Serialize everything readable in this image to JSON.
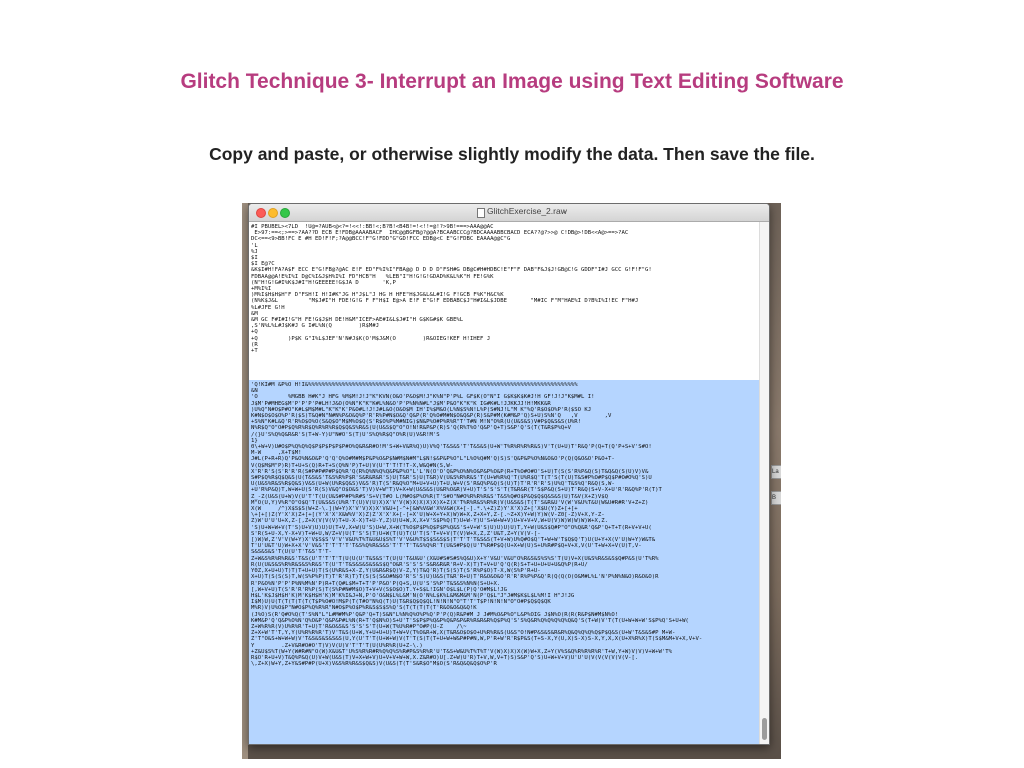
{
  "slide": {
    "title": "Glitch Technique 3- Interrupt an Image using Text Editing Software",
    "subtitle": "Copy and paste, or otherwise slightly modify the data. Then save the file."
  },
  "window": {
    "title": "GlitchExercise_2.raw",
    "title_chevron": "⌄"
  },
  "side_labels": [
    "La",
    "B"
  ],
  "editor": {
    "top_text": "#I PBUBEL><7LD  !U@=?AUB<@<?=!<<!:BB!<;B?B!<B4B!=!<!!=@!?>9B!===>AAA@@AC\n E>97:==<;>==>?AA??D ECB E!FDB@AAAABACF  IHC@@BGFB@?@@A?BCAABCCC@?BDCAAAABBCBACD ECA??@?>>@ C!DB@>!DB<<A@>==>?AC\nDC<==<9>BB!FC E #H ED!F!F;?A@@BCC!F\"G!FDD\"G\"GD!FCC EDB@<C E\"G!FDBC EAAAA@@C\"G\n'L\n%J\n$I\n$I E@?C\n&K$I#H!FA?A$F ECC E\"G!FB@?@AC E!F ED\"F%I%I\"FBA@@ D D D D\"FSH#G DB@C#H#HDBC!E\"F\"F DAB\"F&J$J!GB@C!G GDDF\"I#J GCC G!F!F\"G!\nFDBAA@@A!E%I%I D@C%I&J$H%I%I FD\"HCB\"H   %LEB\"I\"H!G!G!GDAD%K&L%K\"H FE!G%K\n(N\"H!G!G#I%K$J#I\"H!GEEEEE!G$JA D       'K,P\n+M%I%I\n)M%I$H$H$H\"F D\"FSH!I H!I#K\"JG H\"J$L\"J HG H HFE\"H$JG&L&L#I!G F!GCB F%K\"H&C%K\n(N%K$J&L         \"M$J#I\"H FDE!G!G F F\"H$I E@>A E!F E\"G!F EDBABC$J\"H#I&L$JDBE       \"M#IC F\"M\"HAE%I D?B%I%I!EC F\"H#J\n%L#JFE G!H\n&M\n&M GC F#I#I!G\"H FE!G$J$H DE!H&M\"ICEF>AE#I&L$J#I\"H G$KG#$K GBE%L\n,S'N%L%L#J$K#J G I#L%N(Q        )R$M#J\n+Q\n+Q         )P$K G\"I%L$JEF'N'N#J$K(O'M$J&M(O        )R&OIEG!KEF H!IHEF J\n(R\n+T",
    "selected_text": "'Q!KI#M &P%O H!I&%%%%%%%%%%%%%%%%%%%%%%%%%%%%%%%%%%%%%%%%%%%%%%%%%%%%%%%%%%%%%%%%%%%%%%%%%%%%%%%%\n&N\n'O         %MGBB H#K\"J HFG %M$M!J!J\"K\"KVN(O&O'P&O$M!J\"K%N\"P'P%L GF$K(O\"N\"I G$K$K$K#J!H GF!J!J\"K$M#L I!\nJ$M'P#MHEG$M'P'P'P'P#LH!J&O(O%N\"K\"K\"K#L%N&O'P'P%N%N#L\"J$M'P&O\"K\"K\"K IG#K#L!JJKKJJ!H!MKK&R\n)U%Q\"N#O$P#O\"K#L$M$M#L\"K\"K\"K'P&O#L!J!J#L&O(O&O$M IH'I%$M&O(L%N$S%N!L%P(S#NJ!L\"M K\"%Q'R$O$O%P'R($SO KJ\nK#N$O$O$O%P'R($S)T&Q#N\"N#N%P&O&Q%P'R'R%P#N$O&Q'Q&P(R'Q%O#M#N$O&Q&P(R)S&P#M(K#M&P'Q)S+U)S%N'Q   ,V        ,V\n+S%N\"K#L&Q'R'R%O$O%O(S&Q$O\"M$M%O$Q(S'R$O%P%M#NIG)$N&P%O#P%R%R\"T'T#N M!N\"O%R(U(U&S&S)V#P$Q&S&S(U%R!\nN%R$Q\"O\"O#P$Q%R%R$Q%R%R%R$Q$Q&S%R&S(U(U&S$Q\"O\"O!N!R&P&P(R)S'Q(R%T%O'Q&P'Q+T)S&P'Q'S(T(T&R$P%Q+V\n/(}U'S%Q%Q&R&R'S(T+W-Y)U\"N#O'S(T)U'S%Q%R$Q\"O%R(U)V&R!M'S\n1}\n0\\+W+V)U#O$P%Q%Q%Q$P$P$P$P$P#O%Q&R&R#O!M'S+W+V&R%Q)U)V%Q'T&S&S'T'T&S&S(U+W'T%R%R%R%R&S)V'T(U+U)T'R&Q'P(Q+T(Q'P+S+V'S#O!\nM-W     ,X+T$M!\nJ#L(P+R+R)Q'P&O%N&O&P'Q'Q'Q%O#M#M$P&P%O&P$N#M$N#M\"L$N!$&P&P%O\"L\"L%O%Q#M'Q)S)S'Q&P&P%O%N&O&O'P(Q(Q&O&O'P&O+T-\nV(Q$M$M\"P)R)T+U+S(Q)R+T+S(Q%N'P)T+U)V(U'T'T!T!T-X,W&Q#N(S,W-\nX'R'R'S(S'R'R'R(S#P#P#P#P$Q%R'Q(R%Q%N%Q%Q&P&P%O\"L'L'N(O'O'Q&P%O%N%O&P&P%O&P(R+T%O#O#O'S+U)T(S(S'R%P&Q(S)T&Q&Q(S(U)V)V&\nS#P$Q%R$Q$Q&S(U(T&S&S'T&S%R%P$R'S&R&R&R'S)U(T&R'S)U(T&R)V(U&S%R%R&S'T(U+W%R%Q'T(U%R$Q'T(T'S(T(U)T&S#P%O#P$Q$P#O#O%Q'S)U\nU(U&S%R&S%R$Q&S)V&S(U+W(U%R$Q&S)V&S'R)T(S'R&Q%O\"M+U+V+U)T+U,W+V(S'R&Q%P&Q(S(U)T)T'R'R'R'S)U%Q'T&S%Q'R&Q(S,W-\n+U'R%P&Q)T,W+W+U(S'R(S)V&Q\"O$O&S'T)V)V+W\"T)V+X+W(U&S&S(U&R%O&R)V+U)T'S'S'S'T(T&R&R(T'S$P&Q(S+U)T'R&Q(S+V-X+U'R'R&Q%P'R(T)T\nZ_-Z(U&S(U+W)V(U'T'T(U(U&S#P#P%R#S'S+V(T#O L(M#O$P%O%R(T'S#O\"N#O%R%R%R&S'T&S%Q#O$P&Q$Q$Q&S&S(U)T&V(X+Z)V$Q\nM\"O(U,Y)V%R\"O\"O$Q'T(U&S&S(U%R'T(U)V(U)X)X'V'V(W)X)X)X)X)X+Z(X'T%R%R&S%R%R)V(U&S&S(T(T'S&R&U'V(W'V&U%T&U(W&U#R#R'V+Z+Z)\nX(W     /^)X$S$S(W+Z-\\.](W+Y)X'V'V)X)X'V&U+[-^+[&W%V&W'X%V&W(X+[-].*.\\+Z)Z)Y'X'X)Z+['X$U(Y)Z+[+[+\n\\+[+[)Z(Y'X'X)Z+[+[(Y'X'X'X&W%V'X)Z)Z'X'X'X+[-[+X'U)W+X+Y+X)W)W+X,Z+X+Y,Z-[.~Z+X)Y+W)Y)W(V-Z0[-Z)V+X,Y-Z-\nZ)W'U'U'U+X,Z-[,Z+X(V(V(V)T+U-X-X)T+U-Y,Z)U)U+W,X,X+V'S$P%Q(T)U+W-Y)U'S+W+W+V)U+V+V+V,W+U(V)W)W)W)W)W+X,Z.\n'S)U+W+W+V(T'S)U+V)U)U)U(T+V,X+W)U'S)U+W,X+W(T%O$P$P%Q$P$P%Q&S'S+V+W'S)U)U)U)U)T,Y+W(U&S$Q#P\"O\"O%Q&R'Q&P'Q+T+T(R+V+V+U(\nS'R(S+U-X,Y-X+V)T+W+U,W/Z+V)U(T'S'S(T)U+W(T(U)T(U'T(S'T+V+V(T(V)W+X,Z,Z'U&T,Z+Y(V(V-[-\n[)W)W,Z'V'V(W+Y)X'V$S$S'V'V'V&U%T%T&U&U$S%T'V'V&U%T$S$S&S$S(T'T'T'T&S&S(T+V+W)U%Q#O$Q'T+W+W'T$Q$Q'T)U(U+Y+X(V'U)W+Y)W&T&\nT'U'U&T'U)W+X+X'V'V&S'T'T'T'T'T&S%Q%R&S&S'T'T'T'T&S%Q%R'T(U&S#P$Q(U'T%R#P$Q(U+X+W(U)S+U%R#P$Q+V+X,V(U'T+W+X+V(U)T,V-\nS&S&S&S'T(U(U'T'T&S'T'T-\nZ+W&S%R%R%R&S'T&S(U'T'T'T'T(U(U(U'T&S&S'T(U(U'T&U&U'(X&U#S#S#S%Q&U)X+Y'V&U'V&U\"O%R&S&S%S%S'T(U)V+X(U&S%R&S&S$Q#P&S(U'T%R%\nR(U(U&S&S%R%R&S&S%R&S'T(U'T'T&S&S&S&S&S$Q\"O&R'S'S'S'S&R&R&R'R+V-X)T)T+V+U'Q'Q(R)S+T+U+U+U+U&Q%P(R+U/\nY0Z,X+U+U)T)T)T+U+U)T(S(U%R&S+X-Z,Y(U&R&R$Q)V-Z,Y)T&Q'R)T(S(S)T(S'R%P$O)T-X,W(S%P'R+U-\nX+U)T(S(S(S)T,W(S%P%P)T)T'R'R)T)T(S(S(S&O#N$O'R'S'S)U)U&S(T&R'R+U)T'R&O&O&O'R'R'R%P%P&Q'R(Q(Q(O(O&M#L%L'N'P%N%N&O)R&O&O)R\nR'P&O%N'P'P'P%N%M%N'P)R+T(Q#L$M+T+T'P'P&O'P(Q+S,U(U'S'S%P'T&S&S%N%N(S+U+X.\n[,W+V+U)T(S'R'R'R%P(S)T(S%P#N#M$O)T+V+V(S$O$O)T.Y+S$L!IGN'O$L$L(P)Q'O#M$L!JG\nH$L'K$J$H$H'K)M'K$H$H'K)M'K%I&J+N,P'O'O&N$L%L&M'N(O'N%L$K%L&M&M&M'N(P'Q$L\"J\"J#M$K$L$L%M!I H\"J!JG\nI$M)U)U(T(T(T(T(T(T$P%O#O!M$P(T(T#O\"N%Q(T)U(T&R$Q$Q$QL!N!N!N\"O\"T'T'T$P!N!N!N\"O\"O#P$Q$Q$QK\nM%R)V)U%O$P\"N#O$P%Q%R%R\"N#O$P%O$P%R&S$S$S%Q'S(T(T(T(T(T'R&O&O&Q&Q!K\n(J%O)S(R'Q#O%Q(T'S%N\"L\"L#M#M%P'Q&P'Q+T)S&N\"L%N%Q%O%P%Q'P'P(Q)R&P#M J J#M%O&P%O\"L&P%OIG J$N%O(R(R(R&P$N#M$N%O!\nK#M&P'Q'Q&P%O%N'Q%O&P'Q&P&P#L%N(R+T'Q$N%O)S+U'T'S$P$P%Q&P%Q&P&P&R%R&R&R%Q$P%Q'S'S%Q&R%Q%Q%Q%Q%Q&Q'S(T+W)V'T(T(U+W+W+W'S$P%Q'S+U+W(\nZ+W%R%R(V)U%R%R'T+U)T'R&O&S&S'S'S'S'T(U+W(T%U%R#P\"O#P(U-Z    /\\~\nZ+X+W'T'T,Y,Y(U%R%R%R'T)V'T&S(U+W,Y+U+U+U)T+W+V(T%O&R+W,X(T&R&O$O$O+U%R%R&S(U&S\"O!N#P&S&S&R&R%Q&Q%Q%Q%Q$P$Q&S(U+W'T&S&S#P M+W-\nZ'T\"O&S+W+W+W)V'T&S&S&S&S&S(U,Y(U'T'T(U+W+W)V(T'T(S(T(T+U+W+W&P#P#N,W,P'R+W'R'R$P&S(T+S-X,Y(U,X)S-X)S-X,Y,X,X(U+X%R%X)T(S$M&M+V+X,V+V-\nY        .Z+V&R#O#O'T)V)V(U)V'T'T'T(U(U%R%R(U+Z-\\.)\n+Z&U$S%T(W+Y(W#R#N\"O(W)X&U&T'U%S%R%R#R%Q%Q%S%R#P&S%R%R'U'T&S+W&U%T%T%T'V(W)X)X)X(W)W+X,Z+Y(V%S&Q%R%R%R%R'T+W,Y+W)V)V)V+W+W'T%\nR$O'R+U+V)T&Q%P&Q(U)V+W(U&S(T)V+X+W+V)U+V+V+W+W,X.Z&R#O)U[.Z+W)U'R)T+V,W,V+T)S)S&P'Q'S)U+W+V+V)U'U'U(V(V(V(V(V(V-[.\n\\,Z+X)W+Y,Z+Y&S#P#P(U+X)V&S%R%R&S$Q&S)V(U&S(T(T'S&R$O\"M$O(S'R&Q&Q&Q$O%P'R"
  }
}
